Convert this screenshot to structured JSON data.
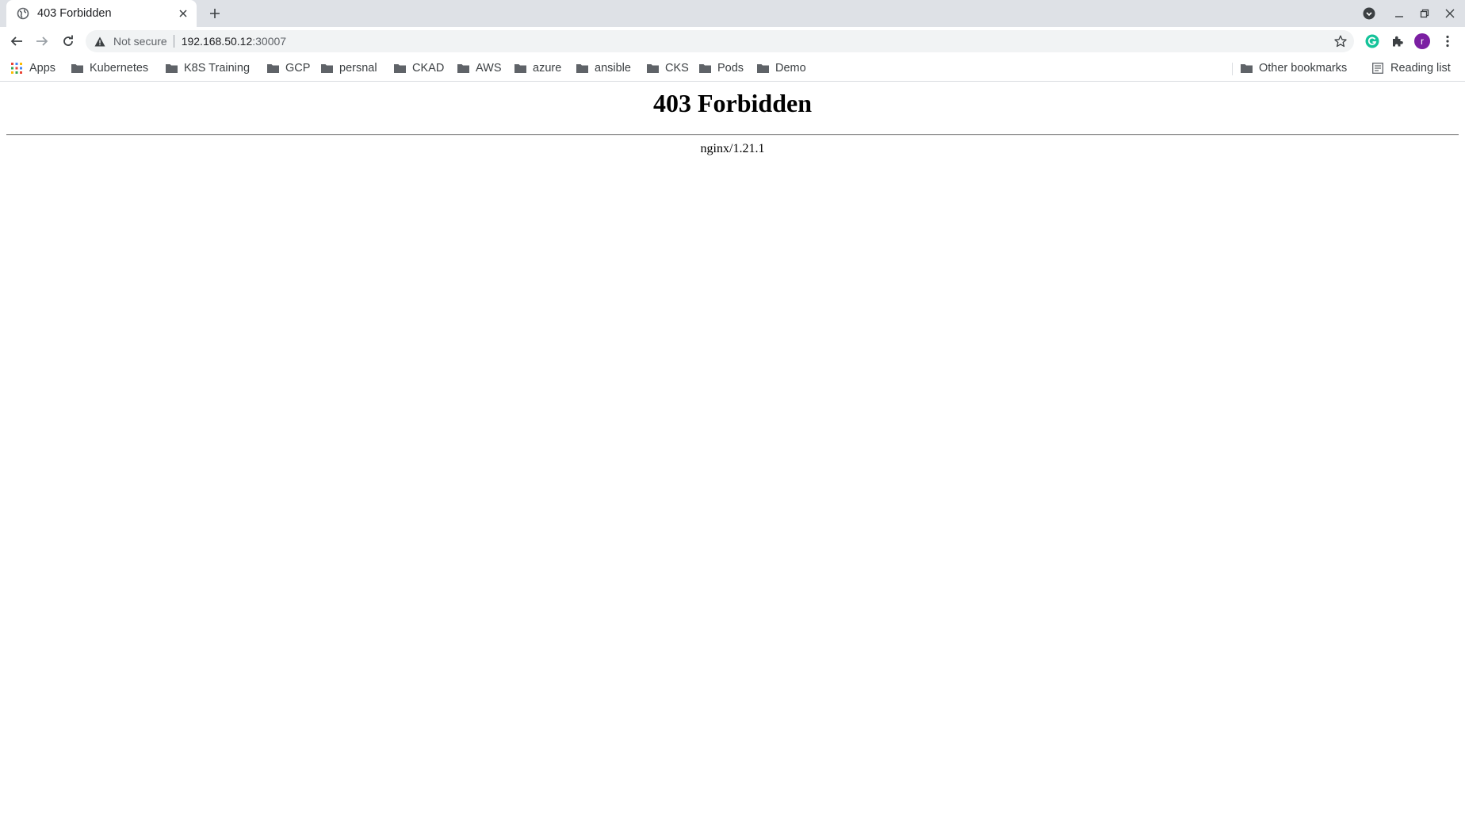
{
  "browser": {
    "tab": {
      "title": "403 Forbidden"
    },
    "address_bar": {
      "security_label": "Not secure",
      "url_host": "192.168.50.12",
      "url_port": ":30007"
    },
    "profile_initial": "r",
    "bookmarks": [
      {
        "label": "Apps",
        "icon": "apps-grid-icon"
      },
      {
        "label": "Kubernetes",
        "icon": "folder-icon"
      },
      {
        "label": "K8S Training",
        "icon": "folder-icon"
      },
      {
        "label": "GCP",
        "icon": "folder-icon"
      },
      {
        "label": "persnal",
        "icon": "folder-icon"
      },
      {
        "label": "CKAD",
        "icon": "folder-icon"
      },
      {
        "label": "AWS",
        "icon": "folder-icon"
      },
      {
        "label": "azure",
        "icon": "folder-icon"
      },
      {
        "label": "ansible",
        "icon": "folder-icon"
      },
      {
        "label": "CKS",
        "icon": "folder-icon"
      },
      {
        "label": "Pods",
        "icon": "folder-icon"
      },
      {
        "label": "Demo",
        "icon": "folder-icon"
      }
    ],
    "other_bookmarks": "Other bookmarks",
    "reading_list": "Reading list"
  },
  "page": {
    "heading": "403 Forbidden",
    "server": "nginx/1.21.1"
  },
  "colors": {
    "tabstrip": "#dee1e6",
    "omnibox": "#f1f3f4",
    "grammarly": "#15c39a",
    "avatar": "#7b1fa2"
  }
}
